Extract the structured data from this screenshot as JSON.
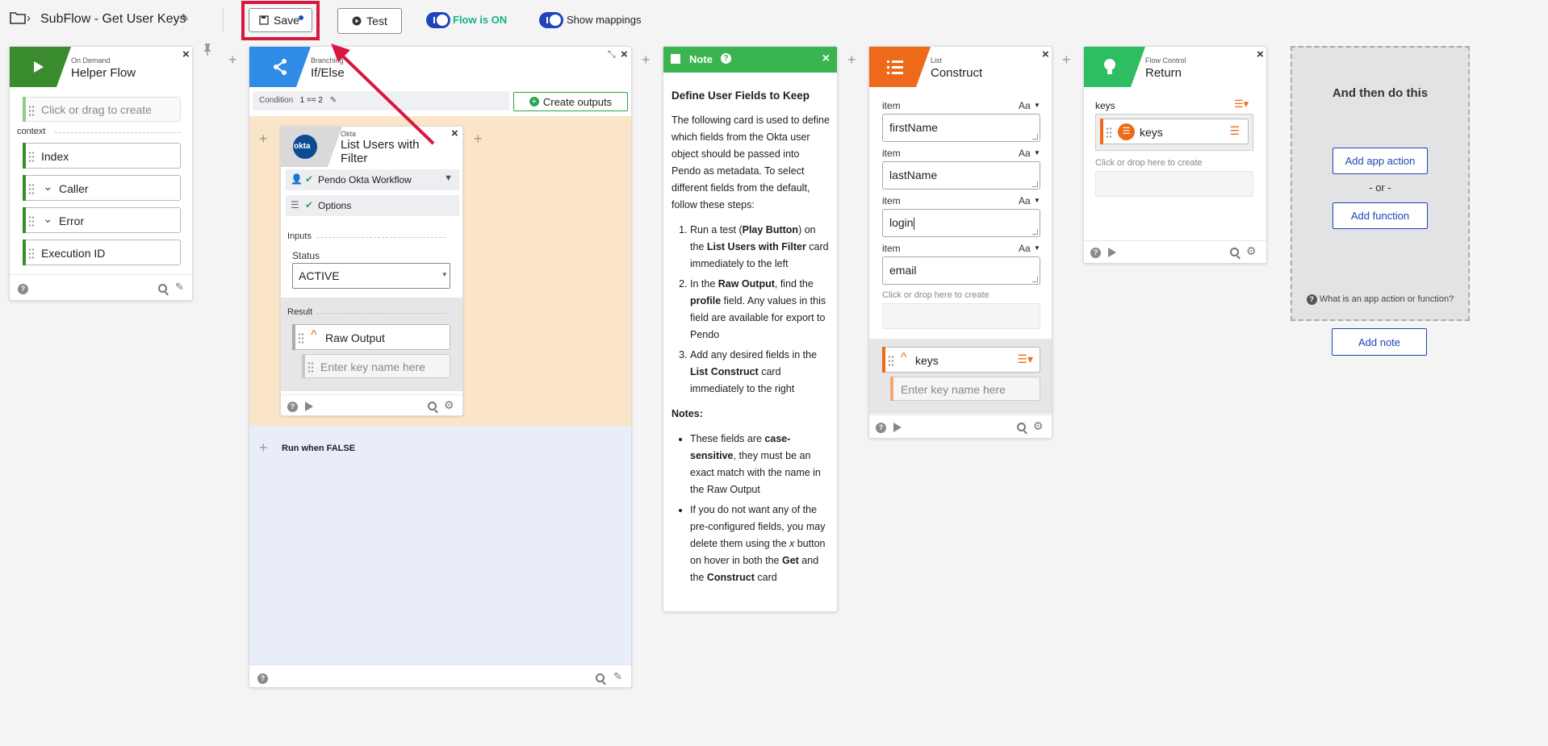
{
  "header": {
    "title": "SubFlow - Get User Keys",
    "save_label": "Save",
    "test_label": "Test",
    "flow_toggle_label": "Flow is ON",
    "mappings_toggle_label": "Show mappings"
  },
  "helper_card": {
    "category": "On Demand",
    "name": "Helper Flow",
    "create_placeholder": "Click or drag to create",
    "context_label": "context",
    "pills": [
      "Index",
      "Caller",
      "Error",
      "Execution ID"
    ]
  },
  "ifelse_card": {
    "category": "Branching",
    "name": "If/Else",
    "condition_label": "Condition",
    "condition_value": "1 == 2",
    "create_outputs_label": "Create outputs",
    "run_false_label": "Run when FALSE"
  },
  "okta_card": {
    "logo_text": "okta",
    "category": "Okta",
    "name": "List Users with Filter",
    "connection": "Pendo Okta Workflow",
    "options_label": "Options",
    "inputs_label": "Inputs",
    "status_label": "Status",
    "status_value": "ACTIVE",
    "result_label": "Result",
    "raw_output_label": "Raw Output",
    "key_placeholder": "Enter key name here"
  },
  "note_card": {
    "title": "Note",
    "heading": "Define User Fields to Keep",
    "intro": "The following card is used to define which fields from the Okta user object should be passed into Pendo as metadata. To select different fields from the default, follow these steps:",
    "steps": [
      {
        "a": "Run a test (",
        "b": "Play Button",
        "c": ") on the ",
        "d": "List Users with Filter",
        "e": " card immediately to the left"
      },
      {
        "a": "In the ",
        "b": "Raw Output",
        "c": ", find the ",
        "d": "profile",
        "e": " field. Any values in this field are available for export to Pendo"
      },
      {
        "a": "Add any desired fields in the ",
        "b": "List Construct",
        "c": " card immediately to the right",
        "d": "",
        "e": ""
      }
    ],
    "notes_heading": "Notes:",
    "notes": [
      {
        "a": "These fields are ",
        "b": "case-sensitive",
        "c": ", they must be an exact match with the name in the Raw Output"
      },
      {
        "a": "If you do not want any of the pre-configured fields, you may delete them using the ",
        "b": "x",
        "c": " button on hover in both the ",
        "d": "Get",
        "e": " and the ",
        "f": "Construct",
        "g": " card"
      }
    ]
  },
  "construct_card": {
    "category": "List",
    "name": "Construct",
    "item_label": "item",
    "type_label": "Aa",
    "items": [
      "firstName",
      "lastName",
      "login",
      "email"
    ],
    "drop_placeholder": "Click or drop here to create",
    "output_label": "keys",
    "key_placeholder": "Enter key name here"
  },
  "return_card": {
    "category": "Flow Control",
    "name": "Return",
    "keys_label": "keys",
    "keys_pill": "keys",
    "drop_placeholder": "Click or drop here to create"
  },
  "add_panel": {
    "heading": "And then do this",
    "add_app_action": "Add app action",
    "or_label": "- or -",
    "add_function": "Add function",
    "help_text": "What is an app action or function?",
    "add_note": "Add note"
  },
  "colors": {
    "accent_blue": "#1f44b8",
    "helper_green": "#3a8a2e",
    "ifelse_blue": "#2f8ce6",
    "note_green": "#3ab44f",
    "construct_orange": "#ee6a1a",
    "return_green": "#2fbd61",
    "highlight_red": "#d8183f"
  }
}
